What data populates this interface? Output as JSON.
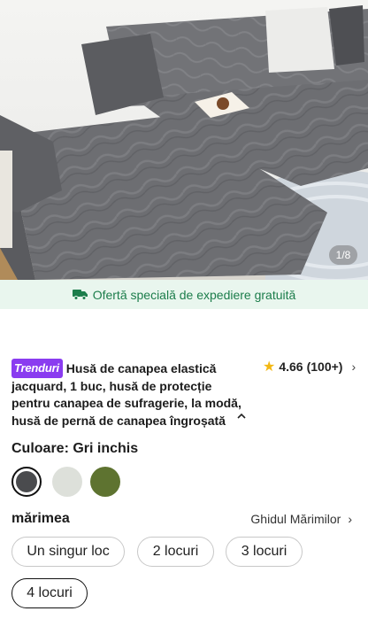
{
  "gallery": {
    "counter": "1/8"
  },
  "shipping": {
    "text": "Ofertă specială de expediere gratuită",
    "icon": "truck-icon",
    "color": "#1c7d4b",
    "bg": "#e9f6ee"
  },
  "product": {
    "badge": "Trenduri",
    "title": "Husă de canapea elastică jacquard, 1 buc, husă de protecție pentru canapea de sufragerie, la modă, husă de pernă de canapea îngroșată",
    "rating": "4.66",
    "reviews": "(100+)"
  },
  "color": {
    "label": "Culoare: Gri inchis",
    "swatches": [
      {
        "name": "Gri inchis",
        "hex": "#4a4b4e",
        "selected": true
      },
      {
        "name": "Crem",
        "hex": "#dde0da",
        "selected": false
      },
      {
        "name": "Verde",
        "hex": "#5e7330",
        "selected": false
      }
    ]
  },
  "size": {
    "label": "mărimea",
    "guide": "Ghidul Mărimilor",
    "options": [
      "Un singur loc",
      "2 locuri",
      "3 locuri",
      "4 locuri"
    ],
    "selected_index": 3
  }
}
